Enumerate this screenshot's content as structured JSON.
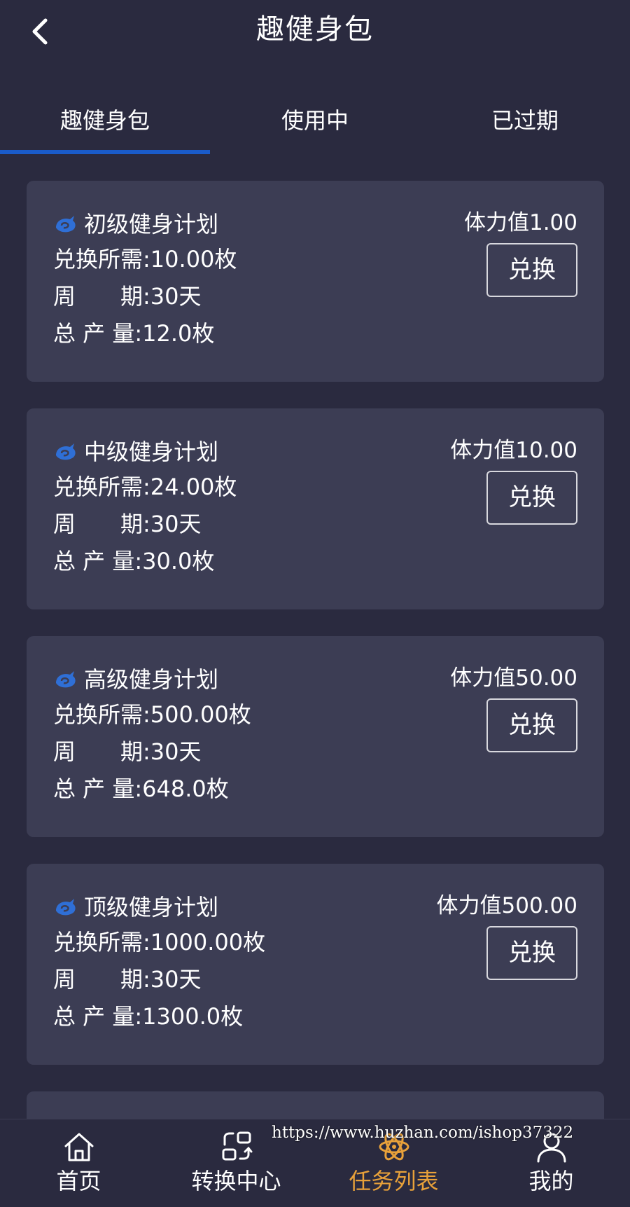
{
  "header": {
    "title": "趣健身包"
  },
  "tabs": [
    {
      "label": "趣健身包",
      "active": true
    },
    {
      "label": "使用中",
      "active": false
    },
    {
      "label": "已过期",
      "active": false
    }
  ],
  "labels": {
    "cost": "兑换所需:",
    "period": "周　　期:",
    "total": "总 产 量:"
  },
  "plans": [
    {
      "name": "初级健身计划",
      "cost": "10.00枚",
      "period": "30天",
      "total": "12.0枚",
      "stamina": "体力值1.00",
      "button": "兑换"
    },
    {
      "name": "中级健身计划",
      "cost": "24.00枚",
      "period": "30天",
      "total": "30.0枚",
      "stamina": "体力值10.00",
      "button": "兑换"
    },
    {
      "name": "高级健身计划",
      "cost": "500.00枚",
      "period": "30天",
      "total": "648.0枚",
      "stamina": "体力值50.00",
      "button": "兑换"
    },
    {
      "name": "顶级健身计划",
      "cost": "1000.00枚",
      "period": "30天",
      "total": "1300.0枚",
      "stamina": "体力值500.00",
      "button": "兑换"
    }
  ],
  "bottom_nav": [
    {
      "label": "首页",
      "icon": "home-icon",
      "active": false
    },
    {
      "label": "转换中心",
      "icon": "exchange-center-icon",
      "active": false
    },
    {
      "label": "任务列表",
      "icon": "task-list-icon",
      "active": true
    },
    {
      "label": "我的",
      "icon": "user-icon",
      "active": false
    }
  ],
  "watermark": "https://www.huzhan.com/ishop37322",
  "colors": {
    "background": "#2a2a3f",
    "card": "#3c3d54",
    "tab_underline": "#1a5bc9",
    "active_nav": "#e8a13a",
    "brand_icon": "#2f6fd6"
  }
}
